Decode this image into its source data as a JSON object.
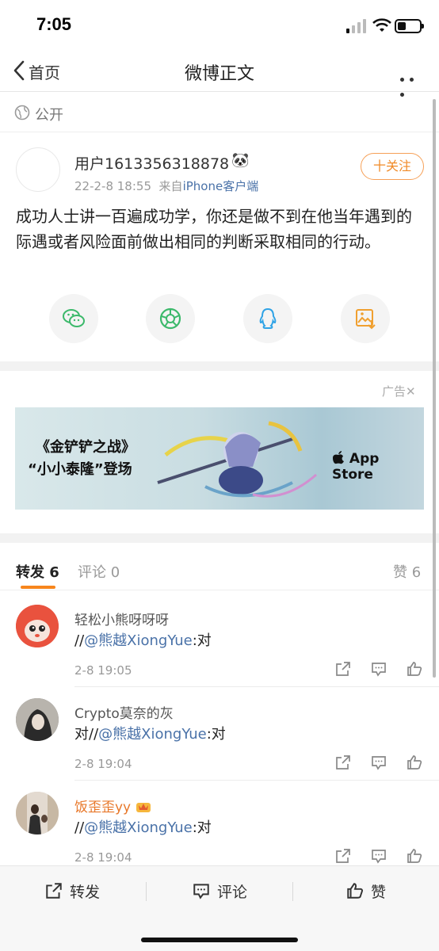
{
  "status_bar": {
    "time": "7:05"
  },
  "nav": {
    "back_label": "首页",
    "title": "微博正文"
  },
  "visibility": {
    "label": "公开"
  },
  "post": {
    "username": "用户1613356318878",
    "emoji": "🐼",
    "time": "22-2-8 18:55",
    "source_prefix": "来自",
    "source": "iPhone客户端",
    "follow_label": "十关注",
    "content": "成功人士讲一百遍成功学，你还是做不到在他当年遇到的际遇或者风险面前做出相同的判断采取相同的行动。",
    "share_icons": [
      "wechat-icon",
      "moments-icon",
      "qq-icon",
      "save-image-icon"
    ]
  },
  "ad": {
    "label": "广告",
    "close": "✕",
    "line1": "《金铲铲之战》",
    "line2": "“小小泰隆”登场",
    "store": "App Store"
  },
  "tabs": {
    "repost": "转发 6",
    "comment": "评论 0",
    "like": "赞 6"
  },
  "reposts": [
    {
      "name": "轻松小熊呀呀呀",
      "prefix": "//",
      "mention": "@熊越XiongYue",
      "suffix": ":对",
      "time": "2-8 19:05"
    },
    {
      "name": "Crypto莫奈的灰",
      "prefix": "对//",
      "mention": "@熊越XiongYue",
      "suffix": ":对",
      "time": "2-8 19:04"
    },
    {
      "name": "饭歪歪yy",
      "prefix": "//",
      "mention": "@熊越XiongYue",
      "suffix": ":对",
      "time": "2-8 19:04"
    }
  ],
  "bottom_bar": {
    "repost": "转发",
    "comment": "评论",
    "like": "赞"
  },
  "colors": {
    "accent": "#f7861c",
    "link": "#4a72a8",
    "follow": "#f08a27"
  }
}
